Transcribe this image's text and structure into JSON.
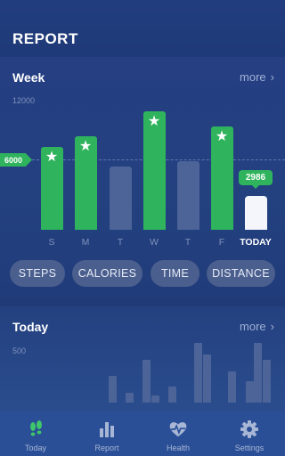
{
  "header": {
    "title": "REPORT"
  },
  "week_card": {
    "title": "Week",
    "more_label": "more",
    "y_max_label": "12000",
    "goal_label": "6000",
    "today_value_label": "2986",
    "days": [
      {
        "label": "S",
        "steps": 7300,
        "goal_met": true
      },
      {
        "label": "M",
        "steps": 8250,
        "goal_met": true
      },
      {
        "label": "T",
        "steps": 5550,
        "goal_met": false
      },
      {
        "label": "W",
        "steps": 10450,
        "goal_met": true
      },
      {
        "label": "T",
        "steps": 6050,
        "goal_met": false
      },
      {
        "label": "F",
        "steps": 9100,
        "goal_met": true
      },
      {
        "label": "TODAY",
        "steps": 2986,
        "goal_met": false,
        "is_today": true
      }
    ],
    "tabs": [
      {
        "label": "STEPS",
        "active": true
      },
      {
        "label": "CALORIES",
        "active": false
      },
      {
        "label": "TIME",
        "active": false
      },
      {
        "label": "DISTANCE",
        "active": false
      }
    ]
  },
  "today_card": {
    "title": "Today",
    "more_label": "more",
    "y_max_label": "500",
    "hourly_steps": [
      0,
      0,
      0,
      0,
      0,
      0,
      0,
      0,
      0,
      0,
      250,
      0,
      90,
      0,
      400,
      70,
      0,
      150,
      0,
      0,
      560,
      450,
      0,
      0,
      290,
      0,
      200,
      560,
      400,
      0
    ]
  },
  "colors": {
    "background": "#203a78",
    "accent_green": "#2fb35d",
    "bar_unmet": "#4c6497",
    "nav_bar": "#2a4f96"
  },
  "nav": {
    "items": [
      {
        "label": "Today",
        "icon": "footsteps-icon",
        "active": true
      },
      {
        "label": "Report",
        "icon": "bar-chart-icon",
        "active": false
      },
      {
        "label": "Health",
        "icon": "heart-pulse-icon",
        "active": false
      },
      {
        "label": "Settings",
        "icon": "gear-icon",
        "active": false
      }
    ]
  }
}
